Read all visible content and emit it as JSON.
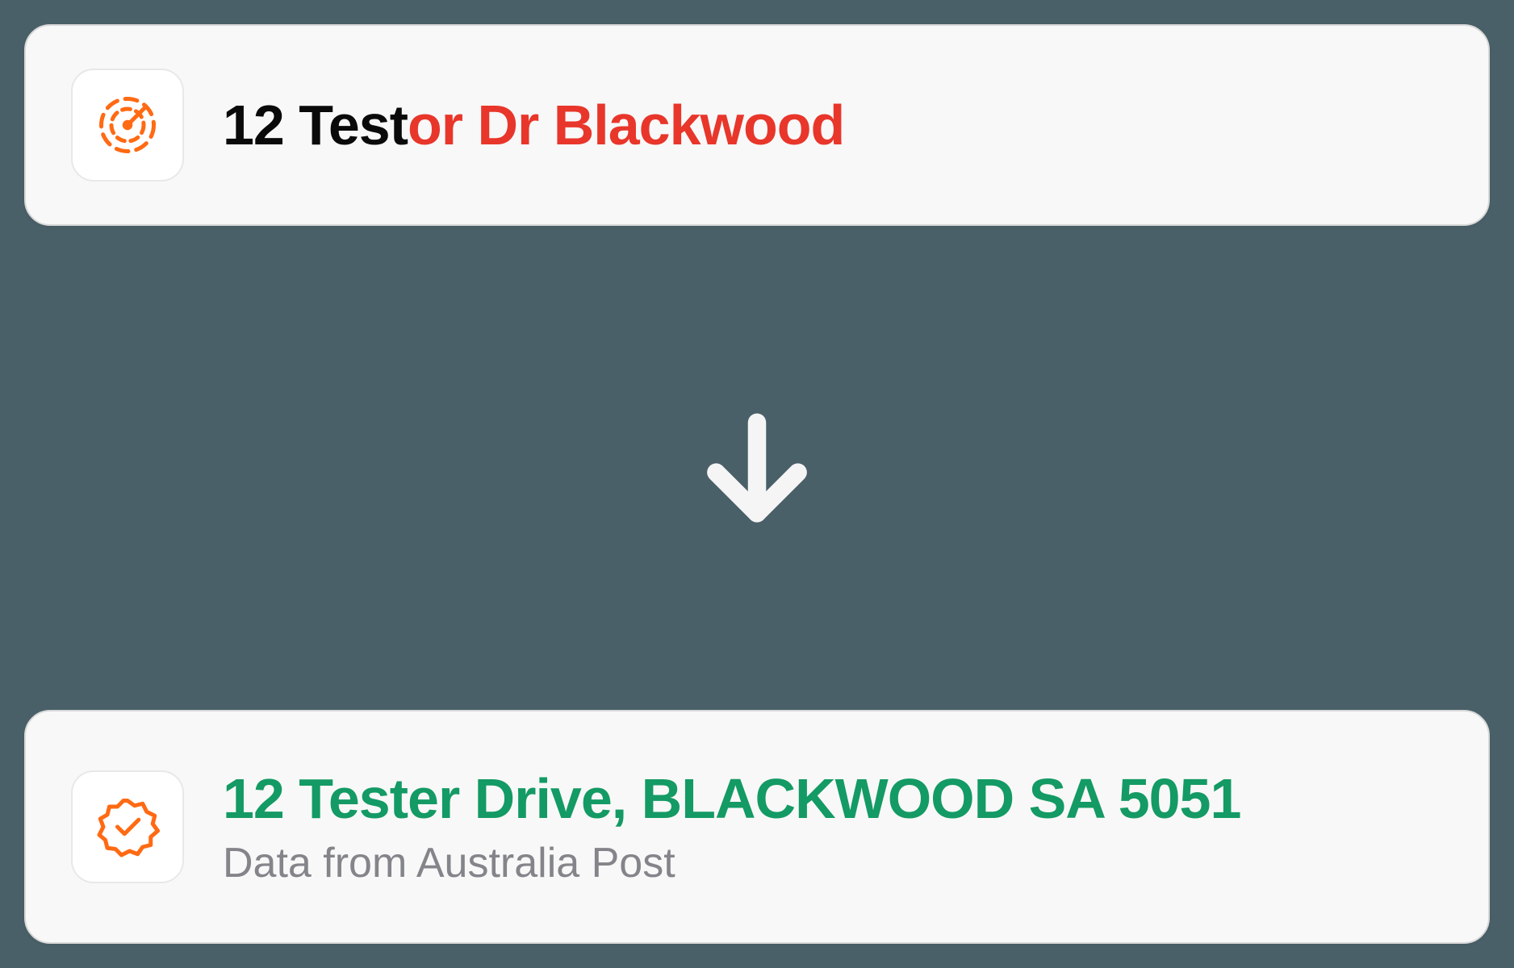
{
  "input": {
    "part1": "12 Test",
    "part2": "or Dr  Blackwood"
  },
  "output": {
    "address": "12 Tester Drive, BLACKWOOD SA 5051",
    "source": "Data from Australia Post"
  },
  "icons": {
    "radar": "radar-icon",
    "verified": "verified-badge-icon",
    "arrow": "arrow-down-icon"
  },
  "colors": {
    "accent": "#ff6a13",
    "error": "#e8362b",
    "success": "#149a64",
    "background": "#4a6068"
  }
}
